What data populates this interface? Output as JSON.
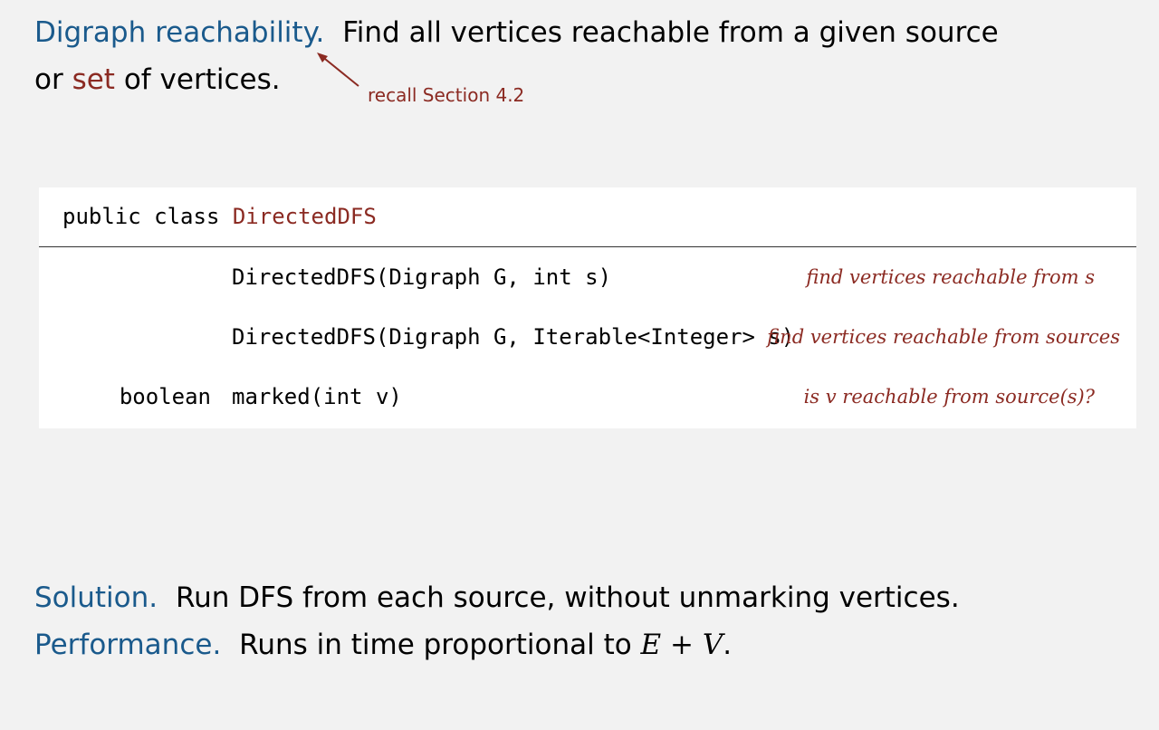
{
  "intro": {
    "term": "Digraph reachability.",
    "text1": "Find all vertices reachable from a given source",
    "text2_pre": "or",
    "text2_set": "set",
    "text2_post": "of vertices.",
    "note": "recall Section 4.2"
  },
  "api": {
    "header_prefix": "public class",
    "class_name": "DirectedDFS",
    "rows": [
      {
        "ret": "",
        "sig": "DirectedDFS(Digraph G, int s)",
        "desc": "find vertices reachable from s"
      },
      {
        "ret": "",
        "sig": "DirectedDFS(Digraph G, Iterable<Integer> s)",
        "desc": "find vertices reachable from sources"
      },
      {
        "ret": "boolean",
        "sig": "marked(int v)",
        "desc": "is v reachable from source(s)?"
      }
    ]
  },
  "solution": {
    "term": "Solution.",
    "text": "Run DFS from each source, without unmarking vertices."
  },
  "performance": {
    "term": "Performance.",
    "text": "Runs in time proportional to",
    "math": "E + V",
    "end": "."
  },
  "colors": {
    "term_blue": "#1a5a8c",
    "accent_red": "#8b2a22"
  }
}
